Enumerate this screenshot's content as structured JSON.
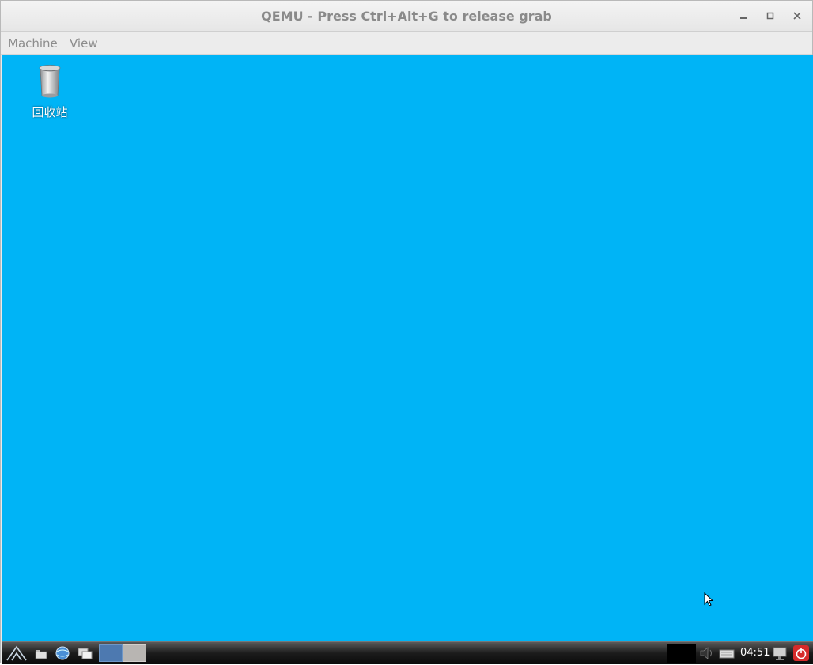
{
  "window": {
    "title": "QEMU - Press Ctrl+Alt+G to release grab",
    "controls": {
      "minimize": "minimize-icon",
      "maximize": "maximize-icon",
      "close": "close-icon"
    }
  },
  "menubar": {
    "items": [
      "Machine",
      "View"
    ]
  },
  "desktop": {
    "background_color": "#00b4f6",
    "icons": [
      {
        "label": "回收站",
        "icon": "trash-can-icon"
      }
    ]
  },
  "taskbar": {
    "start_icon": "start-menu-icon",
    "launchers": [
      "file-manager-icon",
      "web-browser-icon",
      "show-desktop-icon"
    ],
    "workspaces": [
      "workspace-1",
      "workspace-2"
    ],
    "tray": {
      "icons": [
        "volume-icon",
        "keyboard-icon",
        "network-icon",
        "power-icon"
      ],
      "clock": "04:51"
    }
  }
}
